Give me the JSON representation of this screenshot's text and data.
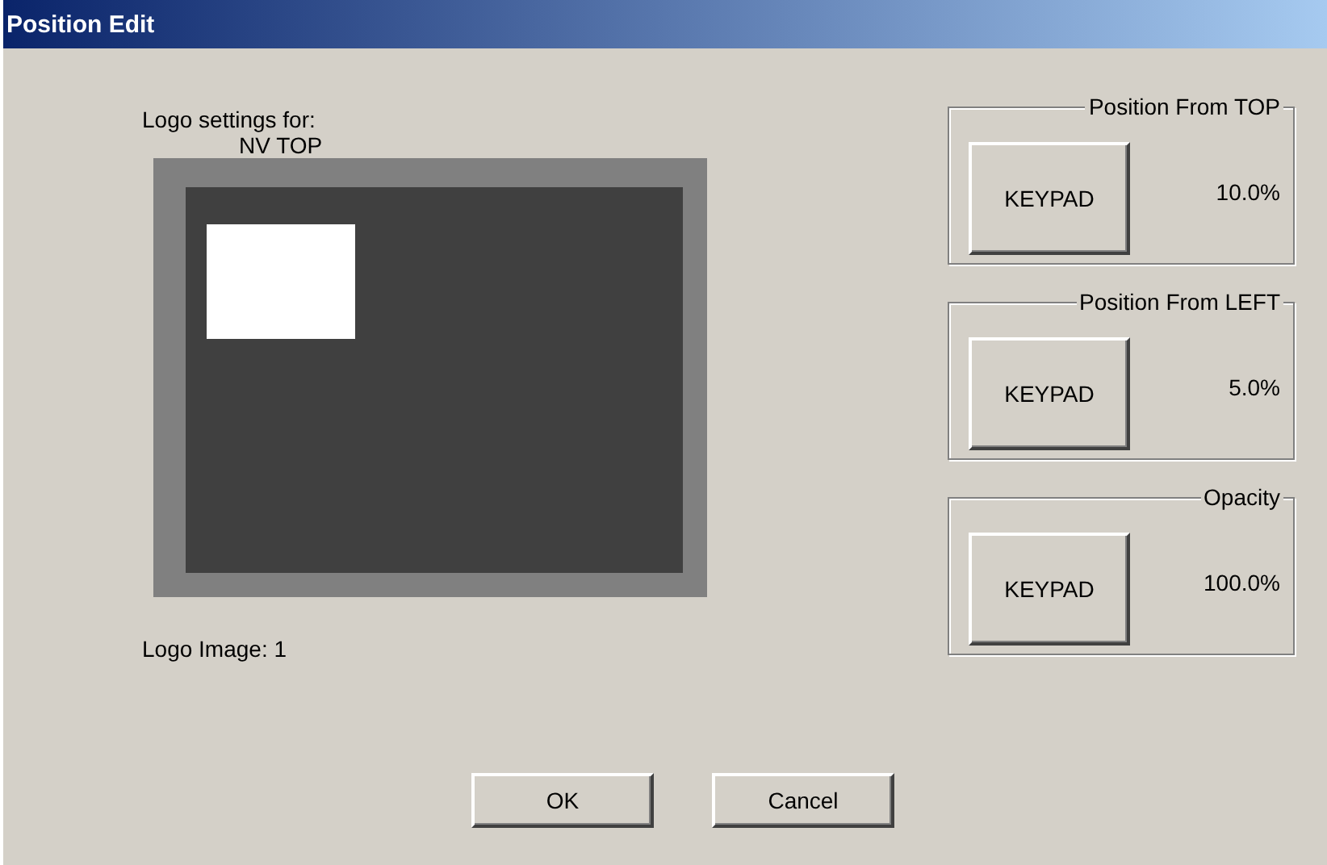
{
  "window": {
    "title": "Position Edit"
  },
  "logo_settings": {
    "label": "Logo settings for:",
    "name": "NV TOP",
    "image_label": "Logo Image: 1"
  },
  "groups": [
    {
      "title": "Position From TOP",
      "button": "KEYPAD",
      "value": "10.0%"
    },
    {
      "title": "Position From LEFT",
      "button": "KEYPAD",
      "value": "5.0%"
    },
    {
      "title": "Opacity",
      "button": "KEYPAD",
      "value": "100.0%"
    }
  ],
  "buttons": [
    "OK",
    "Cancel"
  ]
}
